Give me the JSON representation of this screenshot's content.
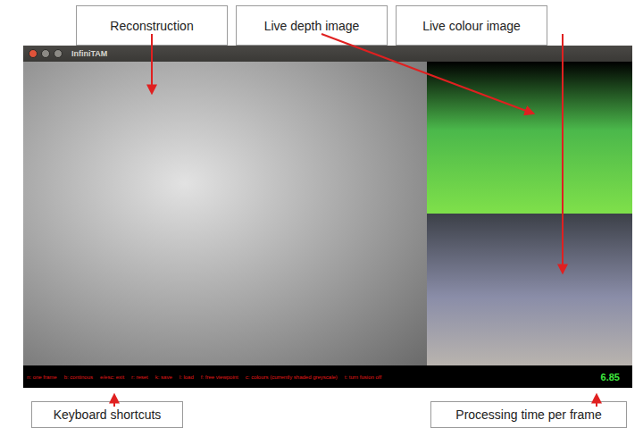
{
  "window": {
    "title": "InfiniTAM"
  },
  "annotations": {
    "top": [
      "Reconstruction",
      "Live depth image",
      "Live colour image"
    ],
    "bottom": [
      "Keyboard shortcuts",
      "Processing time per frame"
    ]
  },
  "shortcuts": [
    "n: one frame",
    "b: continous",
    "e/esc: exit",
    "r: reset",
    "k: save",
    "l: load",
    "f: free viewpoint",
    "c: colours (currently shaded greyscale)",
    "t: turn fusion off"
  ],
  "processing_time": "6.85"
}
